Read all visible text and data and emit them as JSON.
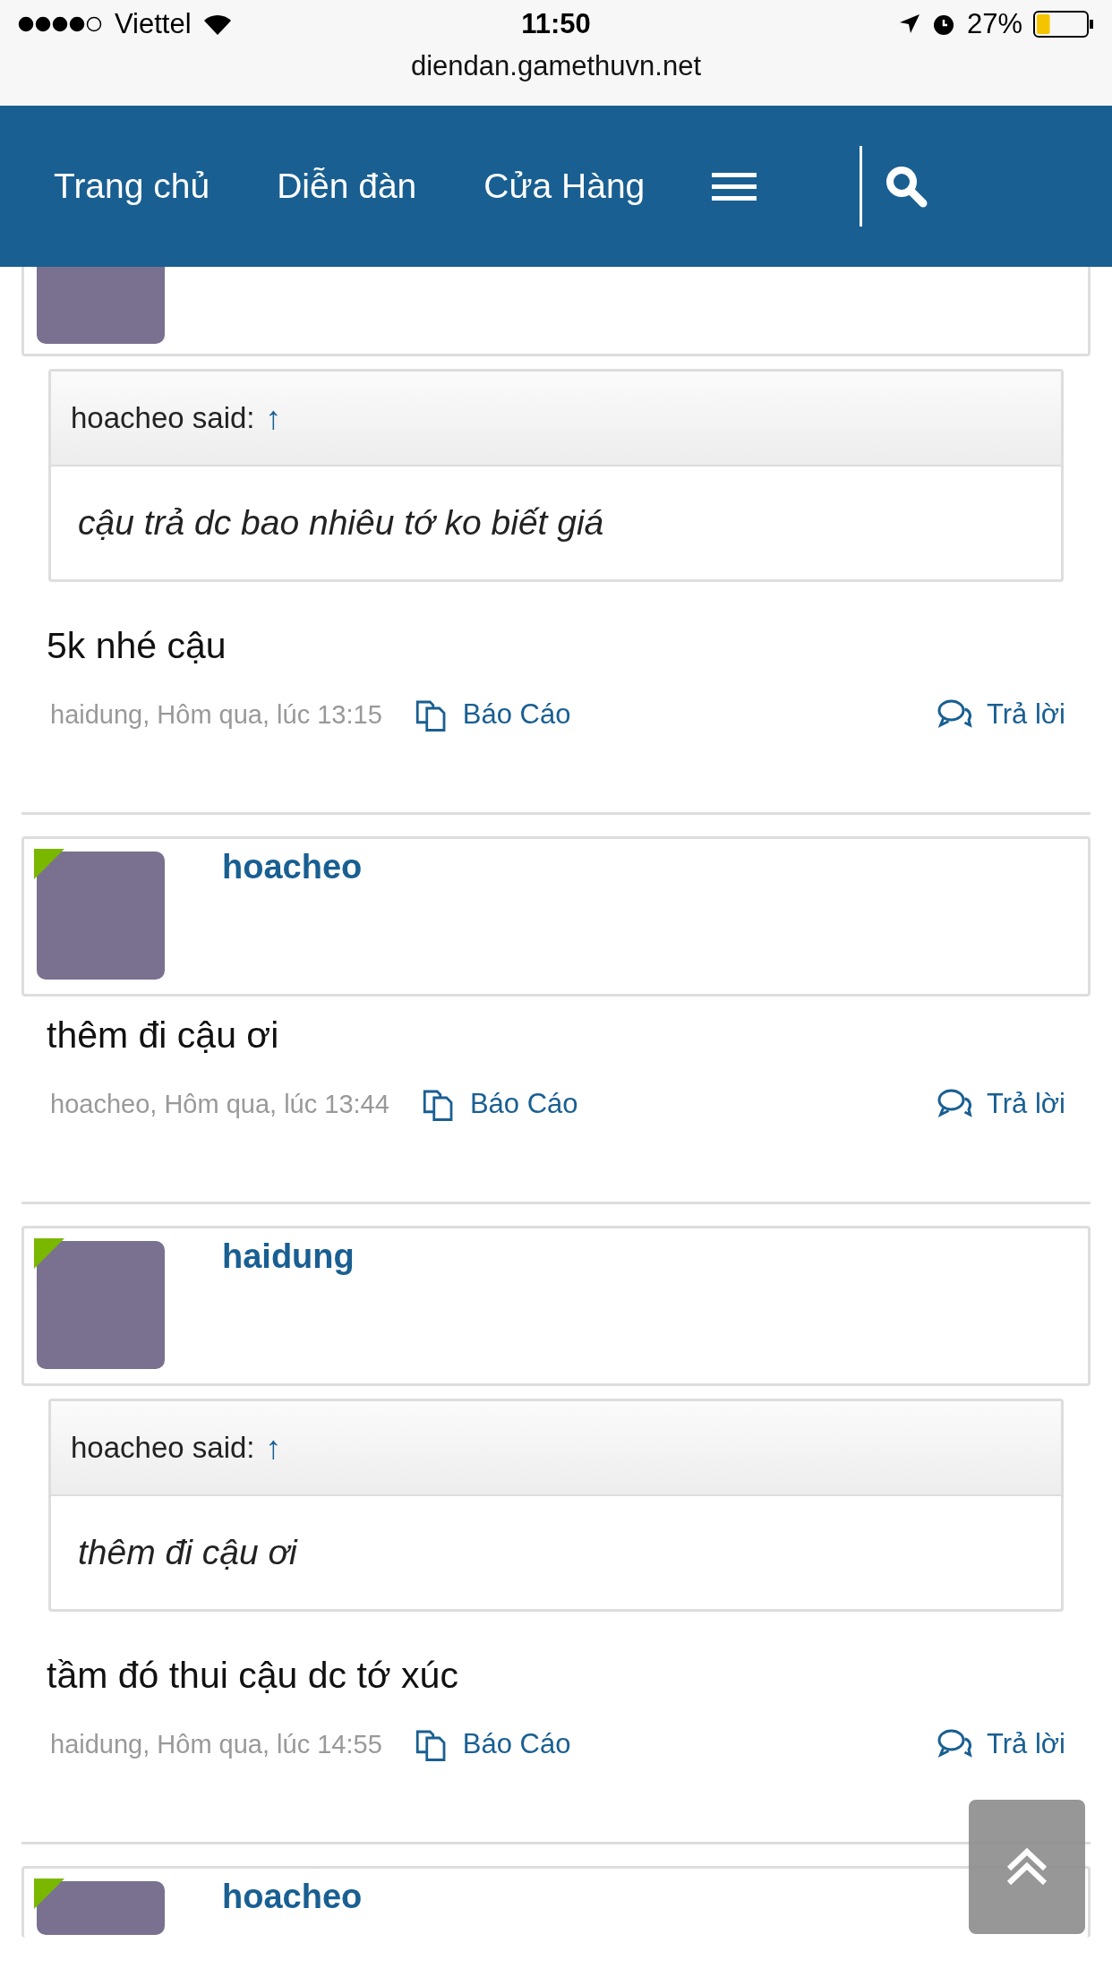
{
  "status_bar": {
    "carrier": "Viettel",
    "time": "11:50",
    "battery": "27%",
    "url": "diendan.gamethuvn.net"
  },
  "nav": {
    "items": [
      "Trang chủ",
      "Diễn đàn",
      "Cửa Hàng"
    ]
  },
  "posts": [
    {
      "kind": "cut_top",
      "quote": {
        "attribution": "hoacheo said:",
        "jump": "↑",
        "text": "cậu trả dc bao nhiêu tớ ko biết giá"
      },
      "body": "5k nhé cậu",
      "meta": "haidung, Hôm qua, lúc 13:15",
      "report": "Báo Cáo",
      "reply": "Trả lời"
    },
    {
      "kind": "full",
      "author": "hoacheo",
      "online": true,
      "body": "thêm đi cậu ơi",
      "meta": "hoacheo, Hôm qua, lúc 13:44",
      "report": "Báo Cáo",
      "reply": "Trả lời"
    },
    {
      "kind": "full",
      "author": "haidung",
      "online": true,
      "quote": {
        "attribution": "hoacheo said:",
        "jump": "↑",
        "text": "thêm đi cậu ơi"
      },
      "body": "tầm đó thui cậu dc tớ xúc",
      "meta": "haidung, Hôm qua, lúc 14:55",
      "report": "Báo Cáo",
      "reply": "Trả lời"
    },
    {
      "kind": "cut_bottom",
      "author": "hoacheo",
      "online": true
    }
  ]
}
